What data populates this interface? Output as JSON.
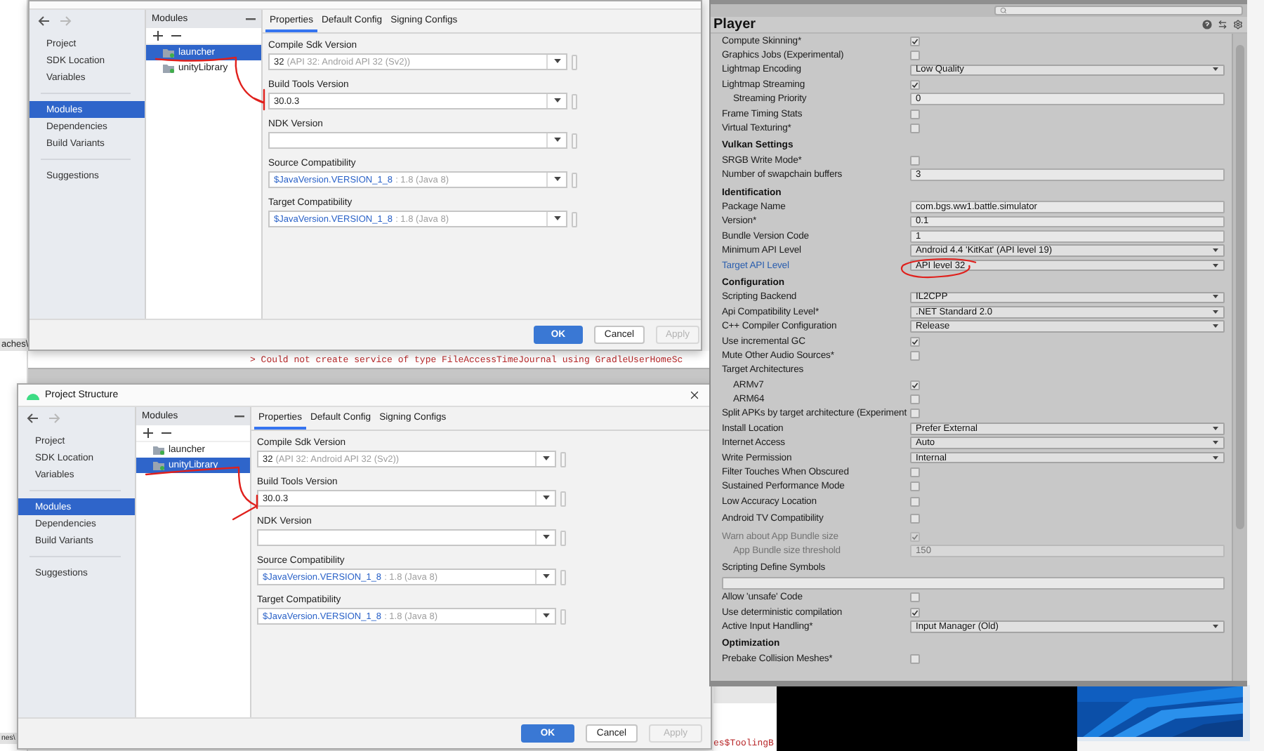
{
  "desktop": {
    "editor_path_top": "aches\\",
    "editor_path_bottom": "nes\\",
    "console_line": "> Could not create service of type FileAccessTimeJournal using GradleUserHomeSc",
    "console_line_bottom": "es$ToolingB"
  },
  "dialogs": [
    {
      "nav_groups": [
        {
          "items": [
            {
              "label": "Project",
              "selected": false
            },
            {
              "label": "SDK Location",
              "selected": false
            },
            {
              "label": "Variables",
              "selected": false
            }
          ]
        },
        {
          "items": [
            {
              "label": "Modules",
              "selected": true
            },
            {
              "label": "Dependencies",
              "selected": false
            },
            {
              "label": "Build Variants",
              "selected": false
            }
          ]
        },
        {
          "items": [
            {
              "label": "Suggestions",
              "selected": false
            }
          ]
        }
      ],
      "modules_title": "Modules",
      "modules": [
        {
          "label": "launcher",
          "selected": true
        },
        {
          "label": "unityLibrary",
          "selected": false
        }
      ],
      "tabs": [
        {
          "label": "Properties",
          "selected": true
        },
        {
          "label": "Default Config",
          "selected": false
        },
        {
          "label": "Signing Configs",
          "selected": false
        }
      ],
      "fields": [
        {
          "label": "Compile Sdk Version",
          "kind": "plain",
          "value": "32",
          "detail": "(API 32: Android API 32 (Sv2))"
        },
        {
          "label": "Build Tools Version",
          "kind": "plain",
          "value": "30.0.3"
        },
        {
          "label": "NDK Version",
          "kind": "plain"
        },
        {
          "label": "Source Compatibility",
          "kind": "reference",
          "value": "$JavaVersion.VERSION_1_8",
          "detail": ": 1.8 (Java 8)"
        },
        {
          "label": "Target Compatibility",
          "kind": "reference",
          "value": "$JavaVersion.VERSION_1_8",
          "detail": ": 1.8 (Java 8)"
        }
      ],
      "buttons": [
        {
          "label": "OK",
          "kind": "primary",
          "disabled": false
        },
        {
          "label": "Cancel",
          "kind": "secondary",
          "disabled": false
        },
        {
          "label": "Apply",
          "kind": "secondary",
          "disabled": true
        }
      ]
    },
    {
      "title": "Project Structure",
      "nav_groups": [
        {
          "items": [
            {
              "label": "Project",
              "selected": false
            },
            {
              "label": "SDK Location",
              "selected": false
            },
            {
              "label": "Variables",
              "selected": false
            }
          ]
        },
        {
          "items": [
            {
              "label": "Modules",
              "selected": true
            },
            {
              "label": "Dependencies",
              "selected": false
            },
            {
              "label": "Build Variants",
              "selected": false
            }
          ]
        },
        {
          "items": [
            {
              "label": "Suggestions",
              "selected": false
            }
          ]
        }
      ],
      "modules_title": "Modules",
      "modules": [
        {
          "label": "launcher",
          "selected": false
        },
        {
          "label": "unityLibrary",
          "selected": true
        }
      ],
      "tabs": [
        {
          "label": "Properties",
          "selected": true
        },
        {
          "label": "Default Config",
          "selected": false
        },
        {
          "label": "Signing Configs",
          "selected": false
        }
      ],
      "fields": [
        {
          "label": "Compile Sdk Version",
          "kind": "plain",
          "value": "32",
          "detail": "(API 32: Android API 32 (Sv2))"
        },
        {
          "label": "Build Tools Version",
          "kind": "plain",
          "value": "30.0.3"
        },
        {
          "label": "NDK Version",
          "kind": "plain"
        },
        {
          "label": "Source Compatibility",
          "kind": "reference",
          "value": "$JavaVersion.VERSION_1_8",
          "detail": ": 1.8 (Java 8)"
        },
        {
          "label": "Target Compatibility",
          "kind": "reference",
          "value": "$JavaVersion.VERSION_1_8",
          "detail": ": 1.8 (Java 8)"
        }
      ],
      "buttons": [
        {
          "label": "OK",
          "kind": "primary",
          "disabled": false
        },
        {
          "label": "Cancel",
          "kind": "secondary",
          "disabled": false
        },
        {
          "label": "Apply",
          "kind": "secondary",
          "disabled": true
        }
      ]
    }
  ],
  "inspector": {
    "title": "Player",
    "sections": [
      {
        "rows": [
          {
            "label": "Compute Skinning*",
            "kind": "checkbox",
            "checked": true,
            "disabled": false,
            "focused": false
          },
          {
            "label": "Graphics Jobs (Experimental)",
            "kind": "checkbox",
            "checked": false,
            "disabled": false,
            "focused": false
          },
          {
            "label": "Lightmap Encoding",
            "kind": "dropdown",
            "value": "Low Quality",
            "disabled": false,
            "focused": false
          },
          {
            "label": "Lightmap Streaming",
            "kind": "checkbox",
            "checked": true,
            "disabled": false,
            "focused": false,
            "children": [
              {
                "label": "Streaming Priority",
                "kind": "field",
                "value": "0",
                "disabled": false,
                "focused": false
              }
            ]
          },
          {
            "label": "Frame Timing Stats",
            "kind": "checkbox",
            "checked": false,
            "disabled": false,
            "focused": false
          },
          {
            "label": "Virtual Texturing*",
            "kind": "checkbox",
            "checked": false,
            "disabled": false,
            "focused": false
          }
        ]
      },
      {
        "header": "Vulkan Settings",
        "rows": [
          {
            "label": "SRGB Write Mode*",
            "kind": "checkbox",
            "checked": false,
            "disabled": false,
            "focused": false
          },
          {
            "label": "Number of swapchain buffers",
            "kind": "field",
            "value": "3",
            "disabled": false,
            "focused": false
          }
        ]
      },
      {
        "header": "Identification",
        "rows": [
          {
            "label": "Package Name",
            "kind": "field",
            "value": "com.bgs.ww1.battle.simulator",
            "disabled": false,
            "focused": false
          },
          {
            "label": "Version*",
            "kind": "field",
            "value": "0.1",
            "disabled": false,
            "focused": false
          },
          {
            "label": "Bundle Version Code",
            "kind": "field",
            "value": "1",
            "disabled": false,
            "focused": false
          },
          {
            "label": "Minimum API Level",
            "kind": "dropdown",
            "value": "Android 4.4 'KitKat' (API level 19)",
            "disabled": false,
            "focused": false
          },
          {
            "label": "Target API Level",
            "kind": "dropdown",
            "value": "API level 32",
            "disabled": false,
            "focused": true
          }
        ]
      },
      {
        "header": "Configuration",
        "rows": [
          {
            "label": "Scripting Backend",
            "kind": "dropdown",
            "value": "IL2CPP",
            "disabled": false,
            "focused": false
          },
          {
            "label": "Api Compatibility Level*",
            "kind": "dropdown",
            "value": ".NET Standard 2.0",
            "disabled": false,
            "focused": false
          },
          {
            "label": "C++ Compiler Configuration",
            "kind": "dropdown",
            "value": "Release",
            "disabled": false,
            "focused": false
          },
          {
            "label": "Use incremental GC",
            "kind": "checkbox",
            "checked": true,
            "disabled": false,
            "focused": false
          },
          {
            "label": "Mute Other Audio Sources*",
            "kind": "checkbox",
            "checked": false,
            "disabled": false,
            "focused": false
          },
          {
            "label": "Target Architectures",
            "kind": "label",
            "disabled": false,
            "focused": false,
            "children": [
              {
                "label": "ARMv7",
                "kind": "checkbox",
                "checked": true,
                "disabled": false,
                "focused": false
              },
              {
                "label": "ARM64",
                "kind": "checkbox",
                "checked": false,
                "disabled": false,
                "focused": false
              }
            ]
          },
          {
            "label": "Split APKs by target architecture (Experiment",
            "kind": "checkbox",
            "checked": false,
            "disabled": false,
            "focused": false
          },
          {
            "label": "Install Location",
            "kind": "dropdown",
            "value": "Prefer External",
            "disabled": false,
            "focused": false
          },
          {
            "label": "Internet Access",
            "kind": "dropdown",
            "value": "Auto",
            "disabled": false,
            "focused": false
          },
          {
            "label": "Write Permission",
            "kind": "dropdown",
            "value": "Internal",
            "disabled": false,
            "focused": false
          },
          {
            "label": "Filter Touches When Obscured",
            "kind": "checkbox",
            "checked": false,
            "disabled": false,
            "focused": false
          },
          {
            "label": "Sustained Performance Mode",
            "kind": "checkbox",
            "checked": false,
            "disabled": false,
            "focused": false
          },
          {
            "label": "Low Accuracy Location",
            "kind": "checkbox",
            "checked": false,
            "disabled": false,
            "focused": false
          }
        ]
      },
      {
        "rows": [
          {
            "label": "Android TV Compatibility",
            "kind": "checkbox",
            "checked": false,
            "disabled": false,
            "focused": false
          }
        ]
      },
      {
        "rows": [
          {
            "label": "Warn about App Bundle size",
            "kind": "checkbox",
            "checked": true,
            "disabled": true,
            "focused": false,
            "children": [
              {
                "label": "App Bundle size threshold",
                "kind": "field",
                "value": "150",
                "disabled": true,
                "focused": false
              }
            ]
          }
        ]
      },
      {
        "rows": [
          {
            "label": "Scripting Define Symbols",
            "kind": "label",
            "disabled": false,
            "focused": false
          },
          {
            "kind": "wide_field"
          },
          {
            "label": "Allow 'unsafe' Code",
            "kind": "checkbox",
            "checked": false,
            "disabled": false,
            "focused": false
          },
          {
            "label": "Use deterministic compilation",
            "kind": "checkbox",
            "checked": true,
            "disabled": false,
            "focused": false
          },
          {
            "label": "Active Input Handling*",
            "kind": "dropdown",
            "value": "Input Manager (Old)",
            "disabled": false,
            "focused": false
          }
        ]
      },
      {
        "header": "Optimization",
        "rows": [
          {
            "label": "Prebake Collision Meshes*",
            "kind": "checkbox",
            "checked": false,
            "disabled": false,
            "focused": false
          }
        ]
      }
    ]
  }
}
